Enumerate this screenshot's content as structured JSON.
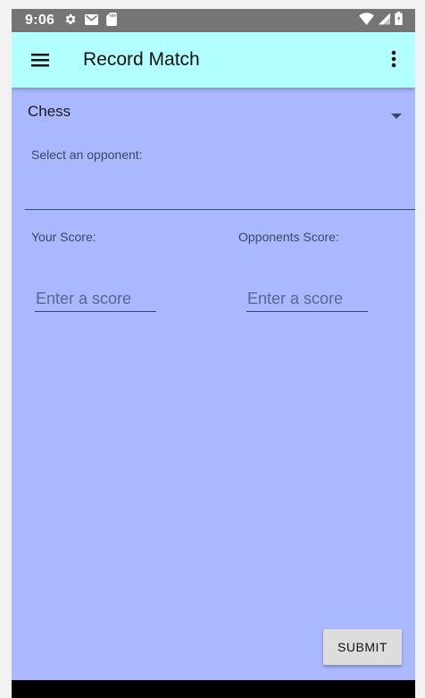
{
  "status_bar": {
    "time": "9:06",
    "left_icons": [
      "gear-icon",
      "mail-icon",
      "sd-card-icon"
    ],
    "right_icons": [
      "wifi-icon",
      "signal-icon",
      "battery-icon"
    ]
  },
  "app_bar": {
    "title": "Record Match",
    "menu_icon": "hamburger-menu-icon",
    "overflow_icon": "more-vert-icon"
  },
  "form": {
    "game_select": {
      "selected": "Chess"
    },
    "opponent": {
      "label": "Select an opponent:",
      "value": ""
    },
    "your_score": {
      "label": "Your Score:",
      "placeholder": "Enter a score",
      "value": ""
    },
    "opponent_score": {
      "label": "Opponents Score:",
      "placeholder": "Enter a score",
      "value": ""
    },
    "submit_label": "SUBMIT"
  },
  "colors": {
    "app_bar": "#b2ffff",
    "background": "#aab9ff",
    "status_bar": "#757575",
    "button": "#dddddd"
  }
}
